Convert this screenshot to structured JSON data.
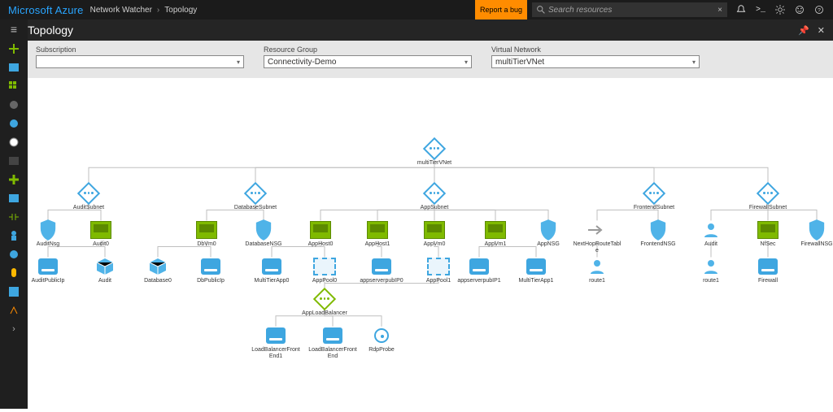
{
  "header": {
    "brand": "Microsoft Azure",
    "breadcrumb": [
      "Network Watcher",
      "Topology"
    ],
    "report_bug": "Report a bug",
    "search_placeholder": "Search resources"
  },
  "page_title": "Topology",
  "filters": {
    "subscription": {
      "label": "Subscription",
      "value": ""
    },
    "resource_group": {
      "label": "Resource Group",
      "value": "Connectivity-Demo"
    },
    "virtual_network": {
      "label": "Virtual Network",
      "value": "multiTierVNet"
    }
  },
  "topology": {
    "vnet": {
      "label": "multiTierVNet"
    },
    "subnets": {
      "audit": {
        "label": "AuditSubnet"
      },
      "database": {
        "label": "DatabaseSubnet"
      },
      "app": {
        "label": "AppSubnet"
      },
      "frontend": {
        "label": "FrontendSubnet"
      },
      "firewall": {
        "label": "FirewallSubnet"
      }
    },
    "nodes": {
      "auditNsg": "AuditNsg",
      "auditVm": "Audit0",
      "auditPubIp": "AuditPublicIp",
      "auditNic": "Audit",
      "dbVm": "DbVm0",
      "dbNsg": "DatabaseNSG",
      "database0": "Database0",
      "dbPubIp": "DbPublicIp",
      "appHost0": "AppHost0",
      "appHost1": "AppHost1",
      "appVm0": "AppVm0",
      "appVm1": "AppVm1",
      "appNsg": "AppNSG",
      "multiTierApp0": "MultiTierApp0",
      "appPool0": "AppPool0",
      "appserverpubIP0": "appserverpubIP0",
      "appPool1": "AppPool1",
      "appserverpubIP1": "appserverpubIP1",
      "multiTierApp1": "MultiTierApp1",
      "appLoadBalancer": "AppLoadBalancer",
      "lbFrontEnd1": "LoadBalancerFrontEnd1",
      "lbFrontEnd": "LoadBalancerFrontEnd",
      "rdpProbe": "RdpProbe",
      "nextHopTable": "NextHopRouteTable",
      "frontendNsg": "FrontendNSG",
      "route1a": "route1",
      "auditFw": "Audit",
      "nfSec": "NfSec",
      "firewallNsg": "FirewallNSG",
      "route1b": "route1",
      "firewall": "Firewall"
    }
  }
}
